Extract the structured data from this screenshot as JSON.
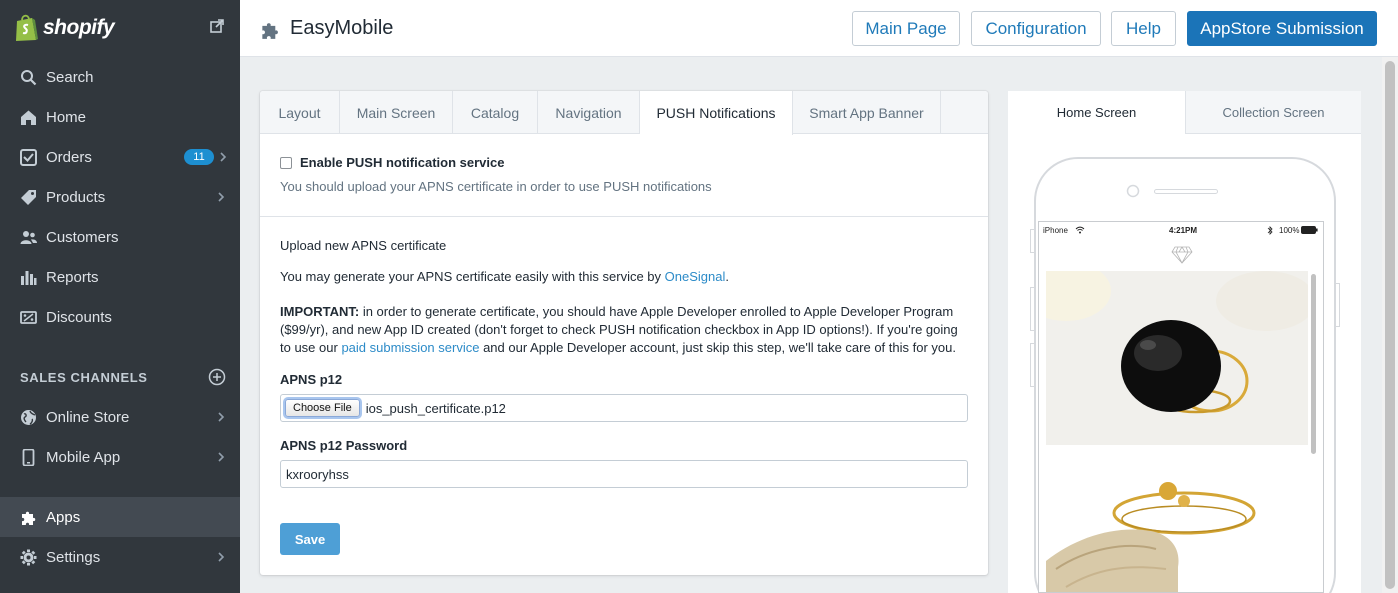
{
  "sidebar": {
    "brand": "shopify",
    "items": [
      {
        "label": "Search",
        "icon": "search-icon"
      },
      {
        "label": "Home",
        "icon": "home-icon"
      },
      {
        "label": "Orders",
        "icon": "orders-icon",
        "badge": "11"
      },
      {
        "label": "Products",
        "icon": "tag-icon"
      },
      {
        "label": "Customers",
        "icon": "customers-icon"
      },
      {
        "label": "Reports",
        "icon": "reports-icon"
      },
      {
        "label": "Discounts",
        "icon": "discounts-icon"
      }
    ],
    "sales_channels_heading": "SALES CHANNELS",
    "channels": [
      {
        "label": "Online Store",
        "icon": "globe-icon"
      },
      {
        "label": "Mobile App",
        "icon": "mobile-icon"
      }
    ],
    "bottom": [
      {
        "label": "Apps",
        "icon": "puzzle-icon"
      },
      {
        "label": "Settings",
        "icon": "gear-icon"
      }
    ]
  },
  "header": {
    "title": "EasyMobile",
    "buttons": {
      "main_page": "Main Page",
      "configuration": "Configuration",
      "help": "Help",
      "appstore": "AppStore Submission"
    }
  },
  "main": {
    "tabs": [
      "Layout",
      "Main Screen",
      "Catalog",
      "Navigation",
      "PUSH Notifications",
      "Smart App Banner"
    ],
    "active_tab": "PUSH Notifications",
    "enable_push_label": "Enable PUSH notification service",
    "enable_push_checked": false,
    "enable_push_hint": "You should upload your APNS certificate in order to use PUSH notifications",
    "upload_link": "Upload new APNS certificate",
    "generate_text_prefix": "You may generate your APNS certificate easily with this service by ",
    "generate_link": "OneSignal",
    "generate_text_suffix": ".",
    "important_label": "IMPORTANT:",
    "important_text_1": " in order to generate certificate, you should have Apple Developer enrolled to Apple Developer Program ($99/yr), and new App ID created (don't forget to check PUSH notification checkbox in App ID options!). If you're going to use our ",
    "important_link": "paid submission service",
    "important_text_2": " and our Apple Developer account, just skip this step, we'll take care of this for you.",
    "apns_label": "APNS p12",
    "choose_file_label": "Choose File",
    "file_name": "ios_push_certificate.p12",
    "password_label": "APNS p12 Password",
    "password_value": "kxrooryhss",
    "save_label": "Save"
  },
  "preview": {
    "tabs": [
      "Home Screen",
      "Collection Screen"
    ],
    "active_tab": "Home Screen",
    "status_carrier": "iPhone",
    "status_time": "4:21PM",
    "status_battery": "100%"
  },
  "colors": {
    "sidebar_bg": "#31373d",
    "accent": "#1b74b8",
    "link": "#2c8bc8",
    "badge": "#1d8fd1"
  }
}
